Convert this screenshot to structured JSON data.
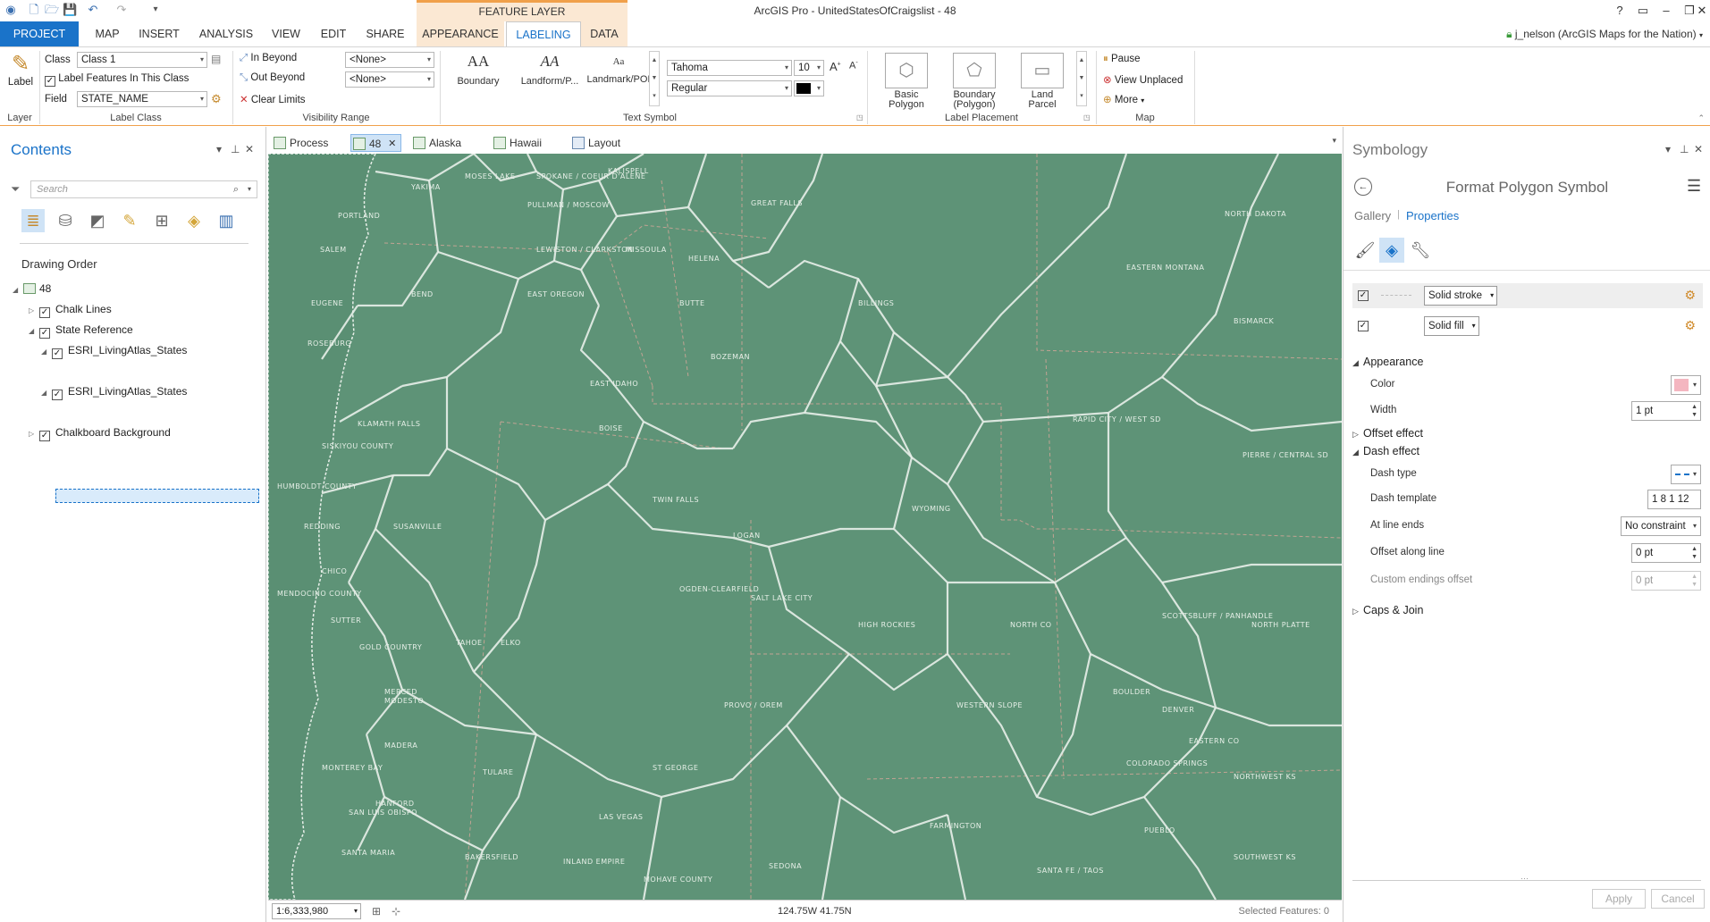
{
  "titlebar": {
    "app_title": "ArcGIS Pro - UnitedStatesOfCraigslist - 48",
    "contextual_header": "FEATURE LAYER",
    "help": "?"
  },
  "tabs": [
    "PROJECT",
    "MAP",
    "INSERT",
    "ANALYSIS",
    "VIEW",
    "EDIT",
    "SHARE",
    "APPEARANCE",
    "LABELING",
    "DATA"
  ],
  "active_tab": "LABELING",
  "user": "j_nelson (ArcGIS Maps for the Nation)",
  "ribbon": {
    "layer": {
      "button": "Label",
      "group": "Layer"
    },
    "label_class": {
      "class_label": "Class",
      "class_value": "Class 1",
      "label_features": "Label Features In This Class",
      "label_features_checked": true,
      "field_label": "Field",
      "field_value": "STATE_NAME",
      "group": "Label Class"
    },
    "visibility": {
      "in_beyond": "In Beyond",
      "out_beyond": "Out Beyond",
      "clear_limits": "Clear Limits",
      "in_value": "<None>",
      "out_value": "<None>",
      "group": "Visibility Range"
    },
    "text_symbol": {
      "gallery": [
        {
          "sample": "AA",
          "name": "Boundary"
        },
        {
          "sample": "AA",
          "name": "Landform/P..."
        },
        {
          "sample": "Aa",
          "name": "Landmark/POI"
        }
      ],
      "font": "Tahoma",
      "size": "10",
      "style": "Regular",
      "group": "Text Symbol"
    },
    "label_placement": {
      "items": [
        [
          "Basic",
          "Polygon"
        ],
        [
          "Boundary",
          "(Polygon)"
        ],
        [
          "Land",
          "Parcel"
        ]
      ],
      "group": "Label Placement"
    },
    "map": {
      "pause": "Pause",
      "view_unplaced": "View Unplaced",
      "more": "More",
      "group": "Map"
    }
  },
  "contents": {
    "title": "Contents",
    "search_placeholder": "Search",
    "drawing_order": "Drawing Order",
    "tree": [
      {
        "label": "48",
        "level": 0,
        "expanded": true,
        "checked": true
      },
      {
        "label": "Chalk Lines",
        "level": 1,
        "expanded": false,
        "checked": true
      },
      {
        "label": "State Reference",
        "level": 1,
        "expanded": true,
        "checked": true
      },
      {
        "label": "ESRI_LivingAtlas_States",
        "level": 2,
        "expanded": true,
        "checked": true
      },
      {
        "label": "ESRI_LivingAtlas_States",
        "level": 2,
        "expanded": true,
        "checked": true
      },
      {
        "label": "Chalkboard Background",
        "level": 1,
        "expanded": false,
        "checked": true
      }
    ]
  },
  "map_tabs": [
    {
      "label": "Process",
      "active": false
    },
    {
      "label": "48",
      "active": true
    },
    {
      "label": "Alaska",
      "active": false
    },
    {
      "label": "Hawaii",
      "active": false
    },
    {
      "label": "Layout",
      "active": false
    }
  ],
  "map": {
    "background_color": "#5e9377",
    "line_color": "#e8efe9",
    "places": [
      "YAKIMA",
      "MOSES LAKE",
      "SPOKANE / COEUR D'ALENE",
      "KALISPELL",
      "GREAT FALLS",
      "NORTH DAKOTA",
      "PORTLAND",
      "PULLMAN / MOSCOW",
      "SALEM",
      "LEWISTON / CLARKSTON",
      "MISSOULA",
      "HELENA",
      "EASTERN MONTANA",
      "EUGENE",
      "BEND",
      "EAST OREGON",
      "BUTTE",
      "BILLINGS",
      "BISMARCK",
      "ROSEBURG",
      "BOZEMAN",
      "EAST IDAHO",
      "KLAMATH FALLS",
      "BOISE",
      "RAPID CITY / WEST SD",
      "SISKIYOU COUNTY",
      "PIERRE / CENTRAL SD",
      "HUMBOLDT COUNTY",
      "TWIN FALLS",
      "WYOMING",
      "REDDING",
      "SUSANVILLE",
      "LOGAN",
      "CHICO",
      "OGDEN-CLEARFIELD",
      "SCOTTSBLUFF / PANHANDLE",
      "MENDOCINO COUNTY",
      "SUTTER",
      "ELKO",
      "SALT LAKE CITY",
      "HIGH ROCKIES",
      "NORTH CO",
      "NORTH PLATTE",
      "GOLD COUNTRY",
      "TAHOE",
      "PROVO / OREM",
      "WESTERN SLOPE",
      "BOULDER",
      "DENVER",
      "MERCED",
      "MODESTO",
      "MADERA",
      "EASTERN CO",
      "COLORADO SPRINGS",
      "MONTEREY BAY",
      "TULARE",
      "ST GEORGE",
      "NORTHWEST KS",
      "HANFORD",
      "SAN LUIS OBISPO",
      "LAS VEGAS",
      "FARMINGTON",
      "PUEBLO",
      "BAKERSFIELD",
      "SANTA MARIA",
      "INLAND EMPIRE",
      "MOHAVE COUNTY",
      "SEDONA",
      "SANTA FE / TAOS",
      "SOUTHWEST KS"
    ]
  },
  "statusbar": {
    "scale": "1:6,333,980",
    "coords": "124.75W 41.75N",
    "selected": "Selected Features: 0"
  },
  "symbology": {
    "title": "Symbology",
    "header": "Format Polygon Symbol",
    "tab_gallery": "Gallery",
    "tab_properties": "Properties",
    "layers": [
      {
        "label": "Solid stroke",
        "checked": true
      },
      {
        "label": "Solid fill",
        "checked": true
      }
    ],
    "appearance": {
      "label": "Appearance",
      "color_label": "Color",
      "color_value": "#f4b6c0",
      "width_label": "Width",
      "width_value": "1 pt"
    },
    "offset_effect": "Offset effect",
    "dash_effect": {
      "label": "Dash effect",
      "dash_type": "Dash type",
      "dash_template": "Dash template",
      "dash_template_value": "1 8 1 12",
      "at_line_ends": "At line ends",
      "at_line_ends_value": "No constraint",
      "offset_along": "Offset along line",
      "offset_along_value": "0 pt",
      "custom_endings": "Custom endings offset",
      "custom_endings_value": "0 pt"
    },
    "caps_join": "Caps & Join",
    "apply": "Apply",
    "cancel": "Cancel"
  }
}
